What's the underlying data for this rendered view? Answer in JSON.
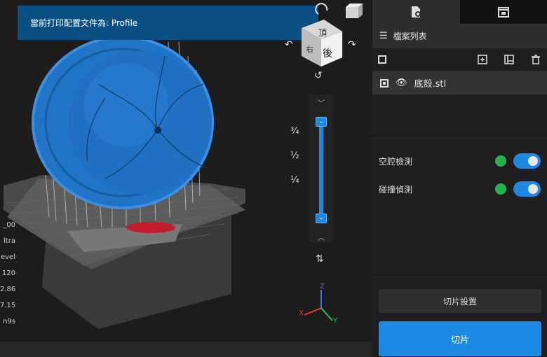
{
  "toast": {
    "text": "當前打印配置文件為: Profile"
  },
  "left_info": [
    "_00",
    "ltra",
    "evel",
    "120",
    "2.86",
    "7.15",
    "n9s"
  ],
  "view_cube": {
    "face_front": "後",
    "face_top": "頂",
    "face_side": "右"
  },
  "layer_slider": {
    "fractions": [
      "¾",
      "½",
      "¼"
    ],
    "upper_thumb_symbol": "–",
    "lower_thumb_symbol": "–"
  },
  "axes": {
    "x": "X",
    "y": "Y",
    "z": "Z"
  },
  "panel": {
    "tabs": [
      "file-settings-tab",
      "printer-tab"
    ],
    "list_title": "檔案列表",
    "files": [
      {
        "name": "底殼.stl"
      }
    ],
    "checks": [
      {
        "label": "空腔檢測",
        "enabled": true
      },
      {
        "label": "碰撞偵測",
        "enabled": true
      }
    ],
    "slice_settings_label": "切片設置",
    "slice_label": "切片"
  },
  "colors": {
    "accent": "#1e88e5",
    "toast_bg": "#0a4f84",
    "ok_green": "#22b14c",
    "model_blue": "#1f74c8"
  }
}
